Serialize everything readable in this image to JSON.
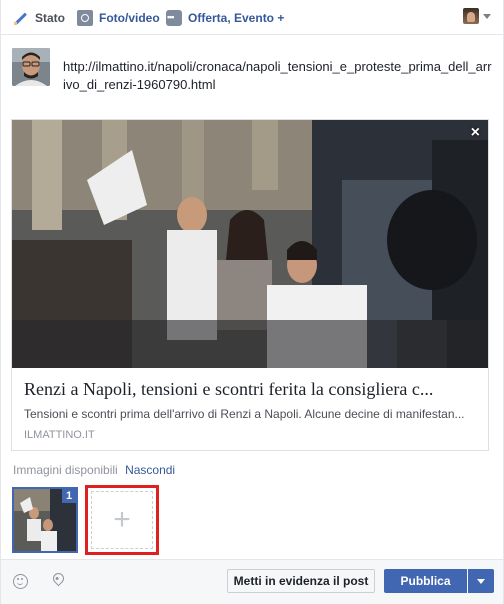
{
  "tabs": [
    {
      "label": "Stato",
      "icon": "pencil-icon",
      "active": true
    },
    {
      "label": "Foto/video",
      "icon": "camera-icon",
      "active": false
    },
    {
      "label": "Offerta, Evento +",
      "icon": "more-dots-icon",
      "active": false
    }
  ],
  "post": {
    "text": "http://ilmattino.it/napoli/cronaca/napoli_tensioni_e_proteste_prima_dell_arrivo_di_renzi-1960790.html"
  },
  "link_preview": {
    "title": "Renzi a Napoli, tensioni e scontri ferita la consigliera c...",
    "description": "Tensioni e scontri prima dell'arrivo di Renzi a Napoli. Alcune decine di manifestan...",
    "domain": "ILMATTINO.IT",
    "close_symbol": "×"
  },
  "images": {
    "label": "Immagini disponibili",
    "hide_label": "Nascondi",
    "selected_count": "1",
    "add_symbol": "+"
  },
  "footer": {
    "boost_label": "Metti in evidenza il post",
    "publish_label": "Pubblica"
  },
  "colors": {
    "brand_blue": "#4267b2",
    "link_blue": "#365899",
    "highlight_red": "#e02020"
  }
}
